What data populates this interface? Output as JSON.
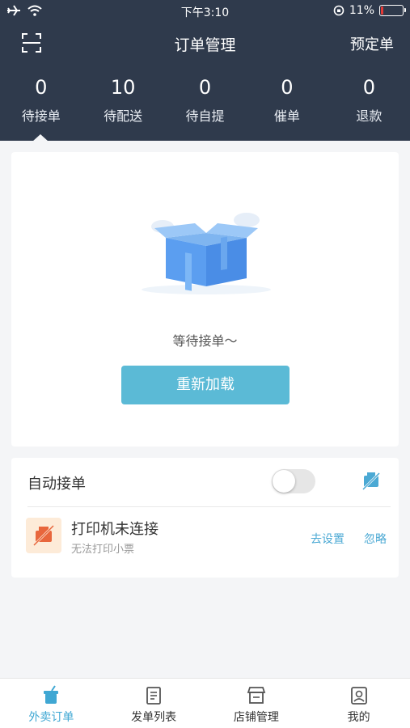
{
  "status_bar": {
    "time": "下午3:10",
    "battery_text": "11%",
    "battery_level": 0.11,
    "battery_color": "#e53935"
  },
  "navbar": {
    "title": "订单管理",
    "right_action": "预定单"
  },
  "stats": [
    {
      "value": "0",
      "label": "待接单"
    },
    {
      "value": "10",
      "label": "待配送"
    },
    {
      "value": "0",
      "label": "待自提"
    },
    {
      "value": "0",
      "label": "催单"
    },
    {
      "value": "0",
      "label": "退款"
    }
  ],
  "empty_state": {
    "message": "等待接单～",
    "reload_label": "重新加载"
  },
  "settings": {
    "auto_accept_label": "自动接单",
    "auto_accept_on": false,
    "printer_title": "打印机未连接",
    "printer_subtitle": "无法打印小票",
    "go_setting_label": "去设置",
    "ignore_label": "忽略"
  },
  "tabbar": [
    {
      "label": "外卖订单",
      "icon": "takeout-cup-icon",
      "active": true
    },
    {
      "label": "发单列表",
      "icon": "list-document-icon",
      "active": false
    },
    {
      "label": "店铺管理",
      "icon": "store-icon",
      "active": false
    },
    {
      "label": "我的",
      "icon": "profile-icon",
      "active": false
    }
  ],
  "colors": {
    "header_bg": "#2f3a4c",
    "accent": "#5bbad6",
    "link": "#4ba9d4",
    "printer_warning_bg": "#fdebd8"
  }
}
